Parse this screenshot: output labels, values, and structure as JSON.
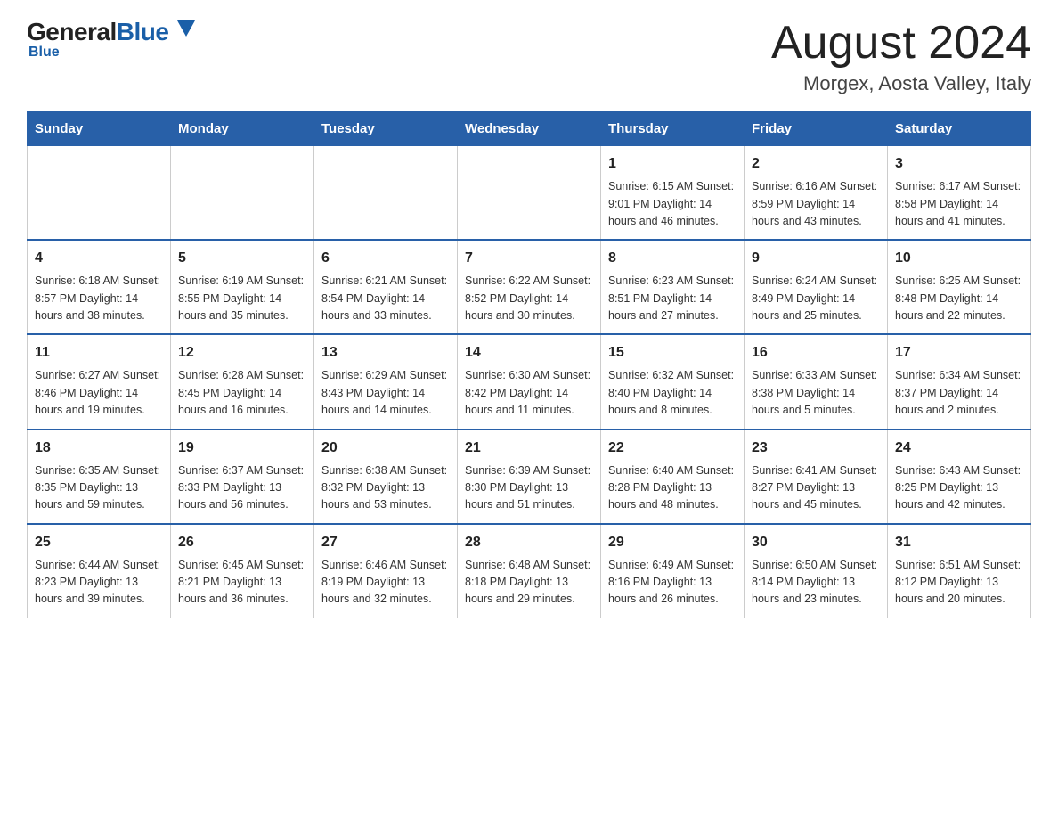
{
  "header": {
    "logo": {
      "general": "General",
      "blue": "Blue"
    },
    "month": "August 2024",
    "location": "Morgex, Aosta Valley, Italy"
  },
  "calendar": {
    "days_of_week": [
      "Sunday",
      "Monday",
      "Tuesday",
      "Wednesday",
      "Thursday",
      "Friday",
      "Saturday"
    ],
    "weeks": [
      [
        {
          "day": "",
          "info": ""
        },
        {
          "day": "",
          "info": ""
        },
        {
          "day": "",
          "info": ""
        },
        {
          "day": "",
          "info": ""
        },
        {
          "day": "1",
          "info": "Sunrise: 6:15 AM\nSunset: 9:01 PM\nDaylight: 14 hours\nand 46 minutes."
        },
        {
          "day": "2",
          "info": "Sunrise: 6:16 AM\nSunset: 8:59 PM\nDaylight: 14 hours\nand 43 minutes."
        },
        {
          "day": "3",
          "info": "Sunrise: 6:17 AM\nSunset: 8:58 PM\nDaylight: 14 hours\nand 41 minutes."
        }
      ],
      [
        {
          "day": "4",
          "info": "Sunrise: 6:18 AM\nSunset: 8:57 PM\nDaylight: 14 hours\nand 38 minutes."
        },
        {
          "day": "5",
          "info": "Sunrise: 6:19 AM\nSunset: 8:55 PM\nDaylight: 14 hours\nand 35 minutes."
        },
        {
          "day": "6",
          "info": "Sunrise: 6:21 AM\nSunset: 8:54 PM\nDaylight: 14 hours\nand 33 minutes."
        },
        {
          "day": "7",
          "info": "Sunrise: 6:22 AM\nSunset: 8:52 PM\nDaylight: 14 hours\nand 30 minutes."
        },
        {
          "day": "8",
          "info": "Sunrise: 6:23 AM\nSunset: 8:51 PM\nDaylight: 14 hours\nand 27 minutes."
        },
        {
          "day": "9",
          "info": "Sunrise: 6:24 AM\nSunset: 8:49 PM\nDaylight: 14 hours\nand 25 minutes."
        },
        {
          "day": "10",
          "info": "Sunrise: 6:25 AM\nSunset: 8:48 PM\nDaylight: 14 hours\nand 22 minutes."
        }
      ],
      [
        {
          "day": "11",
          "info": "Sunrise: 6:27 AM\nSunset: 8:46 PM\nDaylight: 14 hours\nand 19 minutes."
        },
        {
          "day": "12",
          "info": "Sunrise: 6:28 AM\nSunset: 8:45 PM\nDaylight: 14 hours\nand 16 minutes."
        },
        {
          "day": "13",
          "info": "Sunrise: 6:29 AM\nSunset: 8:43 PM\nDaylight: 14 hours\nand 14 minutes."
        },
        {
          "day": "14",
          "info": "Sunrise: 6:30 AM\nSunset: 8:42 PM\nDaylight: 14 hours\nand 11 minutes."
        },
        {
          "day": "15",
          "info": "Sunrise: 6:32 AM\nSunset: 8:40 PM\nDaylight: 14 hours\nand 8 minutes."
        },
        {
          "day": "16",
          "info": "Sunrise: 6:33 AM\nSunset: 8:38 PM\nDaylight: 14 hours\nand 5 minutes."
        },
        {
          "day": "17",
          "info": "Sunrise: 6:34 AM\nSunset: 8:37 PM\nDaylight: 14 hours\nand 2 minutes."
        }
      ],
      [
        {
          "day": "18",
          "info": "Sunrise: 6:35 AM\nSunset: 8:35 PM\nDaylight: 13 hours\nand 59 minutes."
        },
        {
          "day": "19",
          "info": "Sunrise: 6:37 AM\nSunset: 8:33 PM\nDaylight: 13 hours\nand 56 minutes."
        },
        {
          "day": "20",
          "info": "Sunrise: 6:38 AM\nSunset: 8:32 PM\nDaylight: 13 hours\nand 53 minutes."
        },
        {
          "day": "21",
          "info": "Sunrise: 6:39 AM\nSunset: 8:30 PM\nDaylight: 13 hours\nand 51 minutes."
        },
        {
          "day": "22",
          "info": "Sunrise: 6:40 AM\nSunset: 8:28 PM\nDaylight: 13 hours\nand 48 minutes."
        },
        {
          "day": "23",
          "info": "Sunrise: 6:41 AM\nSunset: 8:27 PM\nDaylight: 13 hours\nand 45 minutes."
        },
        {
          "day": "24",
          "info": "Sunrise: 6:43 AM\nSunset: 8:25 PM\nDaylight: 13 hours\nand 42 minutes."
        }
      ],
      [
        {
          "day": "25",
          "info": "Sunrise: 6:44 AM\nSunset: 8:23 PM\nDaylight: 13 hours\nand 39 minutes."
        },
        {
          "day": "26",
          "info": "Sunrise: 6:45 AM\nSunset: 8:21 PM\nDaylight: 13 hours\nand 36 minutes."
        },
        {
          "day": "27",
          "info": "Sunrise: 6:46 AM\nSunset: 8:19 PM\nDaylight: 13 hours\nand 32 minutes."
        },
        {
          "day": "28",
          "info": "Sunrise: 6:48 AM\nSunset: 8:18 PM\nDaylight: 13 hours\nand 29 minutes."
        },
        {
          "day": "29",
          "info": "Sunrise: 6:49 AM\nSunset: 8:16 PM\nDaylight: 13 hours\nand 26 minutes."
        },
        {
          "day": "30",
          "info": "Sunrise: 6:50 AM\nSunset: 8:14 PM\nDaylight: 13 hours\nand 23 minutes."
        },
        {
          "day": "31",
          "info": "Sunrise: 6:51 AM\nSunset: 8:12 PM\nDaylight: 13 hours\nand 20 minutes."
        }
      ]
    ]
  }
}
